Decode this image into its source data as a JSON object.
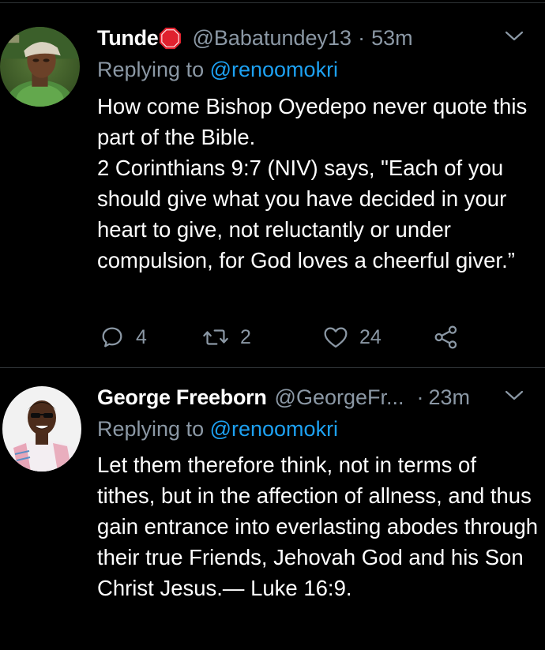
{
  "tweets": [
    {
      "display_name": "Tunde",
      "has_badge": true,
      "badge_icon": "stop-sign-emoji",
      "handle": "@Babatundey13",
      "separator": "·",
      "time": "53m",
      "replying_prefix": "Replying to ",
      "replying_to": "@renoomokri",
      "text": "How come Bishop Oyedepo never quote this part of the Bible.\n2 Corinthians 9:7 (NIV) says, \"Each of you should give what you have decided in your heart to give, not reluctantly or under compulsion, for God loves a cheerful giver.”",
      "actions": {
        "reply_count": "4",
        "retweet_count": "2",
        "like_count": "24"
      }
    },
    {
      "display_name": "George Freeborn",
      "has_badge": false,
      "handle": "@GeorgeFr...",
      "separator": "·",
      "time": "23m",
      "replying_prefix": "Replying to ",
      "replying_to": "@renoomokri",
      "text": "Let them therefore think, not in terms of tithes, but in the affection of allness, and thus gain entrance into everlasting abodes through their true Friends, Jehovah God and his Son Christ Jesus.— Luke 16:9."
    }
  ],
  "colors": {
    "background": "#000000",
    "text_primary": "#ffffff",
    "text_secondary": "#8b98a5",
    "link": "#1da1f2",
    "divider": "#2f3336"
  },
  "icons": [
    "reply-icon",
    "retweet-icon",
    "like-icon",
    "share-icon",
    "chevron-down-icon",
    "stop-sign-emoji"
  ]
}
